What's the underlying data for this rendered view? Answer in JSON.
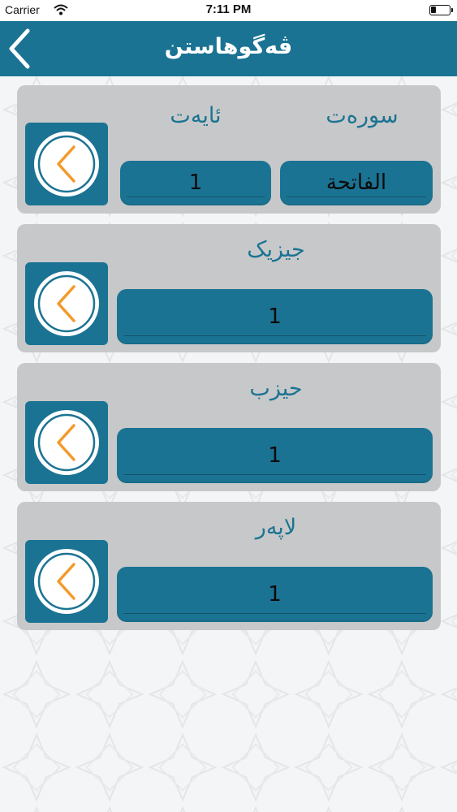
{
  "status": {
    "carrier": "Carrier",
    "time": "7:11 PM"
  },
  "header": {
    "title": "ڤەگوهاستن"
  },
  "sections": {
    "surah_ayah": {
      "surah_label": "سورەت",
      "ayah_label": "ئایەت",
      "surah_value": "الفاتحة",
      "ayah_value": "1"
    },
    "juz": {
      "label": "جیزیک",
      "value": "1"
    },
    "hizb": {
      "label": "حیزب",
      "value": "1"
    },
    "page": {
      "label": "لاپەر",
      "value": "1"
    }
  },
  "colors": {
    "primary": "#1b7393",
    "card": "#c7c8c9",
    "accent": "#f39a2a"
  },
  "icons": {
    "back": "chevron-left-icon",
    "go": "circle-chevron-left-icon"
  }
}
